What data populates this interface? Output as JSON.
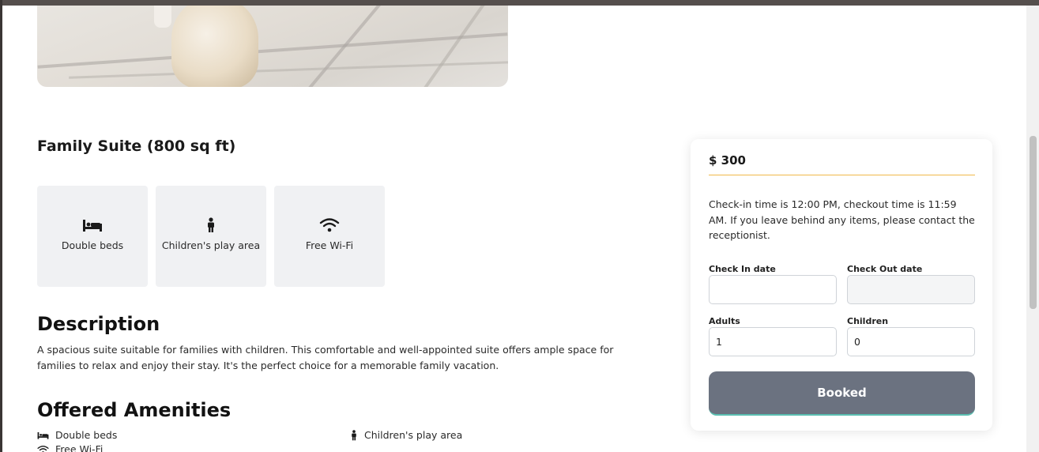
{
  "room": {
    "title": "Family Suite (800 sq ft)",
    "features": [
      {
        "icon": "bed-icon",
        "label": "Double beds"
      },
      {
        "icon": "child-icon",
        "label": "Children's play area"
      },
      {
        "icon": "wifi-icon",
        "label": "Free Wi-Fi"
      }
    ]
  },
  "description": {
    "heading": "Description",
    "text": "A spacious suite suitable for families with children. This comfortable and well-appointed suite offers ample space for families to relax and enjoy their stay. It's the perfect choice for a memorable family vacation."
  },
  "amenities": {
    "heading": "Offered Amenities",
    "items": [
      {
        "icon": "bed-icon",
        "label": "Double beds"
      },
      {
        "icon": "child-icon",
        "label": "Children's play area"
      },
      {
        "icon": "wifi-icon",
        "label": "Free Wi-Fi"
      }
    ]
  },
  "booking": {
    "price": "$ 300",
    "policy": "Check-in time is 12:00 PM, checkout time is 11:59 AM. If you leave behind any items, please contact the receptionist.",
    "check_in_label": "Check In date",
    "check_in_value": "",
    "check_out_label": "Check Out date",
    "check_out_value": "",
    "adults_label": "Adults",
    "adults_value": "1",
    "children_label": "Children",
    "children_value": "0",
    "button_label": "Booked"
  },
  "colors": {
    "accent_line": "#f0b94a",
    "button_bg": "#6b7280",
    "feature_bg": "#f0f1f3"
  }
}
